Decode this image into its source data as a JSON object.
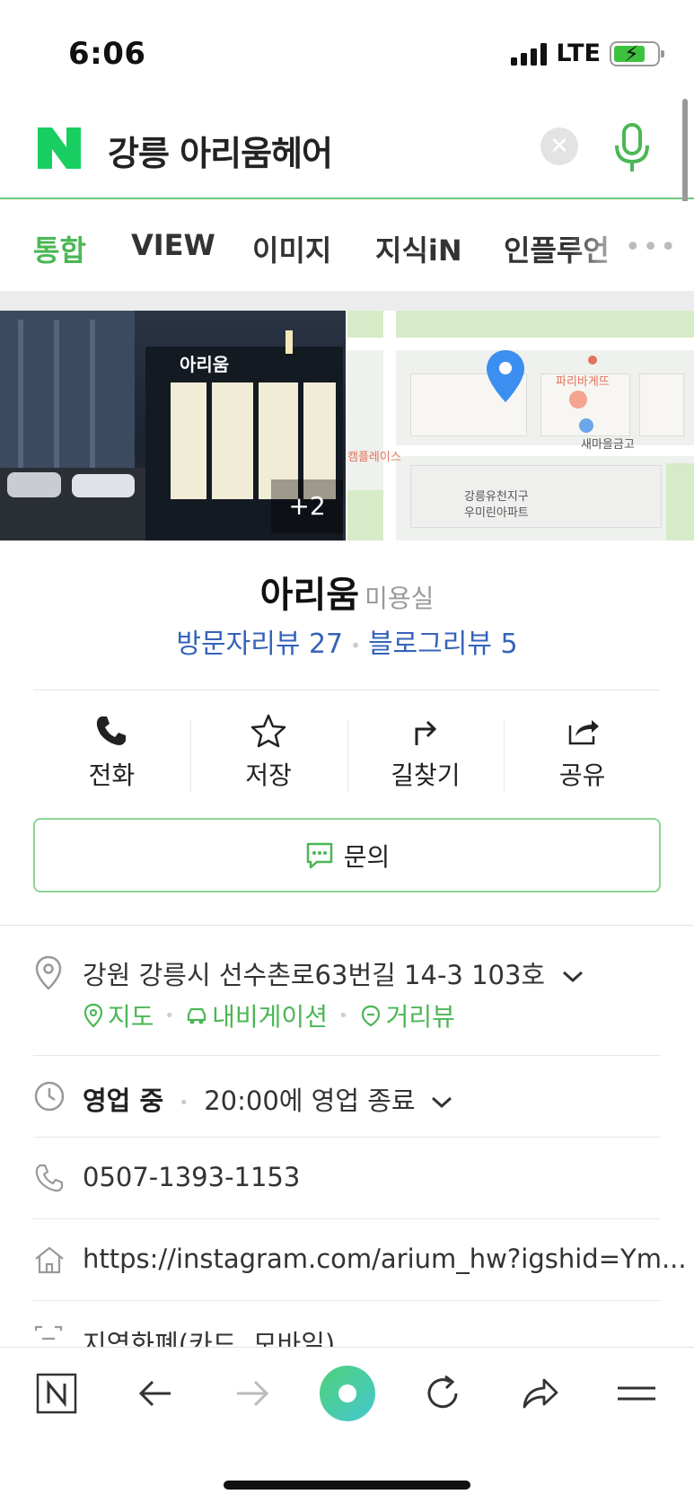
{
  "status": {
    "time": "6:06",
    "network": "LTE"
  },
  "search": {
    "query": "강릉 아리움헤어"
  },
  "tabs": [
    {
      "label": "통합",
      "active": true
    },
    {
      "label": "VIEW",
      "active": false
    },
    {
      "label": "이미지",
      "active": false
    },
    {
      "label": "지식iN",
      "active": false
    },
    {
      "label": "인플루언",
      "active": false
    }
  ],
  "tabs_more": "•••",
  "photo": {
    "sign": "아리움",
    "more_count": "+2"
  },
  "map": {
    "labels": [
      "파리바게뜨",
      "새마을금고",
      "캠플레이스",
      "강릉유천지구",
      "우미린아파트"
    ]
  },
  "place": {
    "name": "아리움",
    "category": "미용실",
    "visitor_reviews": "방문자리뷰 27",
    "blog_reviews": "블로그리뷰 5"
  },
  "actions": [
    "전화",
    "저장",
    "길찾기",
    "공유"
  ],
  "inquiry": "문의",
  "info": {
    "address": "강원 강릉시 선수촌로63번길 14-3 103호",
    "map_link": "지도",
    "navi_link": "내비게이션",
    "street_link": "거리뷰",
    "status": "영업 중",
    "hours": "20:00에 영업 종료",
    "phone": "0507-1393-1153",
    "url": "https://instagram.com/arium_hw?igshid=Ym...",
    "payment": "지역화폐(카드, 모바일)"
  },
  "colors": {
    "accent": "#4bb756",
    "review_blue": "#3563b8"
  }
}
